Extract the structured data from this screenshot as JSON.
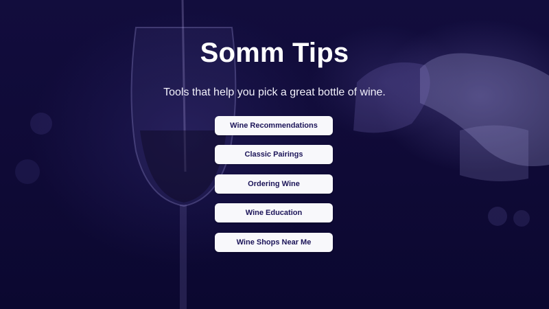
{
  "title": "Somm Tips",
  "subtitle": "Tools that help you pick a great bottle of wine.",
  "menu": [
    {
      "label": "Wine Recommendations"
    },
    {
      "label": "Classic Pairings"
    },
    {
      "label": "Ordering Wine"
    },
    {
      "label": "Wine Education"
    },
    {
      "label": "Wine Shops Near Me"
    }
  ],
  "colors": {
    "background_overlay": "#120d3d",
    "button_background": "#f8f8fb",
    "button_text": "#1b1458",
    "title_text": "#ffffff"
  }
}
